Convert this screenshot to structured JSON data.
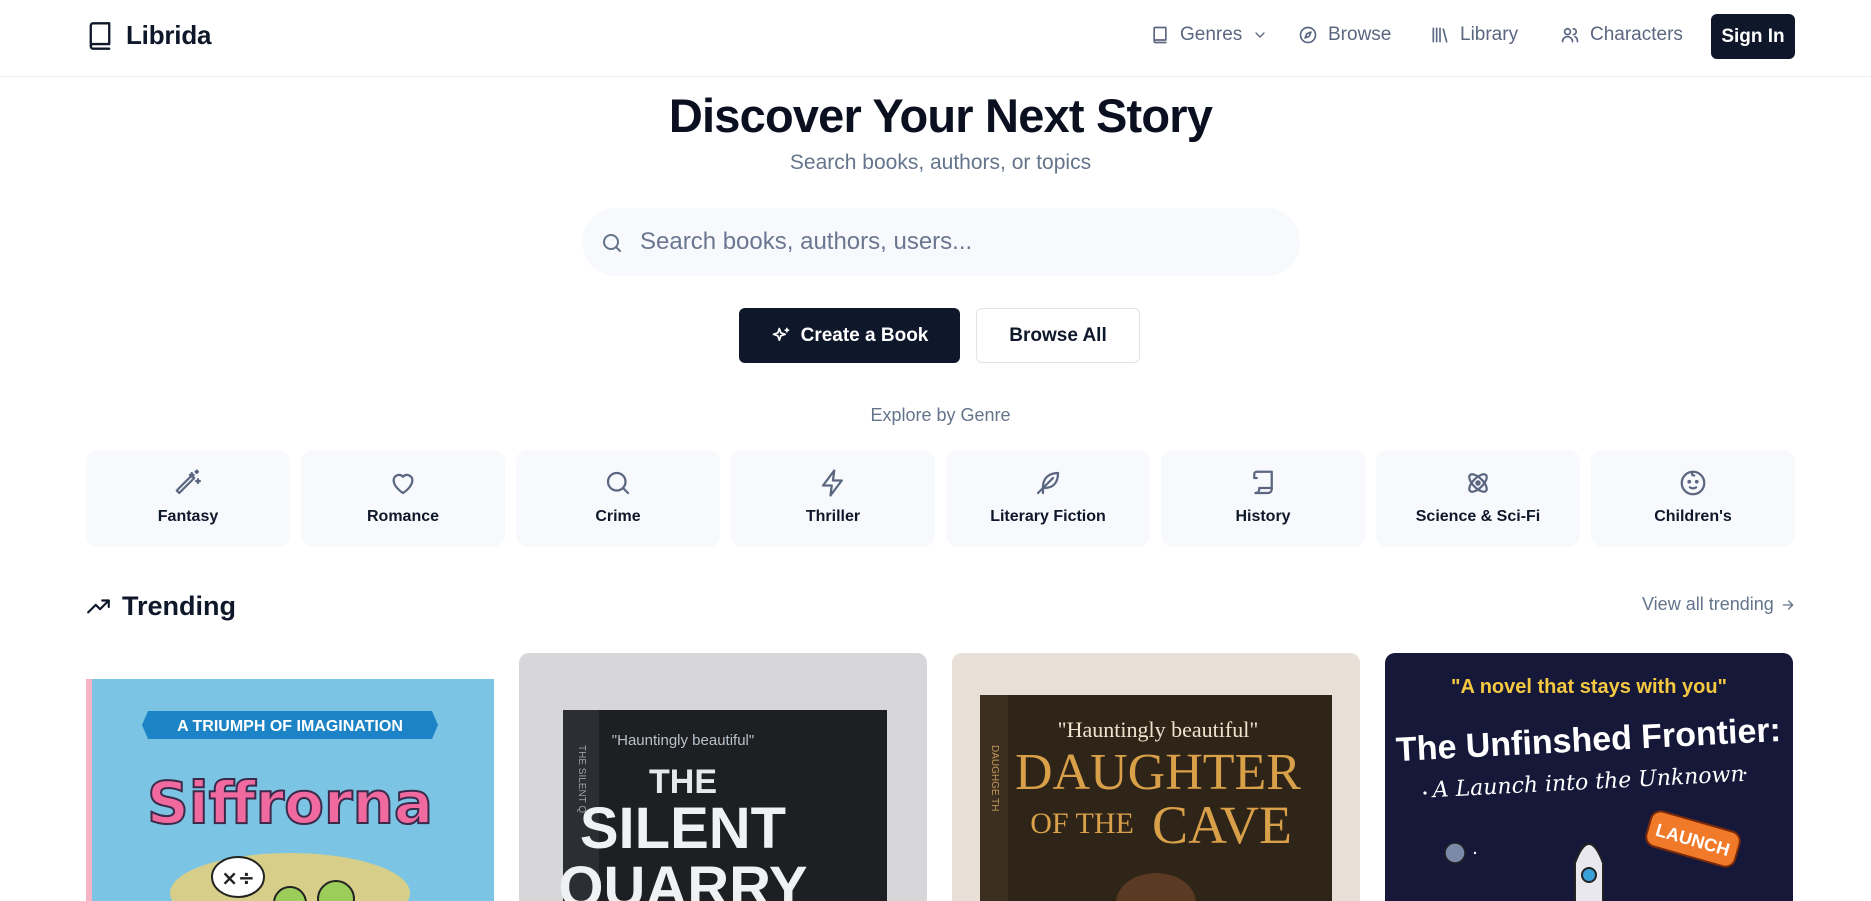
{
  "header": {
    "brand": "Librida",
    "nav": [
      {
        "label": "Genres",
        "icon": "book-icon"
      },
      {
        "label": "Browse",
        "icon": "compass-icon"
      },
      {
        "label": "Library",
        "icon": "library-icon"
      },
      {
        "label": "Characters",
        "icon": "users-icon"
      }
    ],
    "signin": "Sign In"
  },
  "hero": {
    "title": "Discover Your Next Story",
    "subtitle": "Search books, authors, or topics",
    "search_placeholder": "Search books, authors, users...",
    "create_button": "Create a Book",
    "browse_button": "Browse All"
  },
  "explore_label": "Explore by Genre",
  "genres": [
    {
      "label": "Fantasy",
      "icon": "magic-wand-icon"
    },
    {
      "label": "Romance",
      "icon": "heart-icon"
    },
    {
      "label": "Crime",
      "icon": "search-icon"
    },
    {
      "label": "Thriller",
      "icon": "lightning-icon"
    },
    {
      "label": "Literary Fiction",
      "icon": "feather-icon"
    },
    {
      "label": "History",
      "icon": "scroll-icon"
    },
    {
      "label": "Science & Sci-Fi",
      "icon": "atom-icon"
    },
    {
      "label": "Children's",
      "icon": "baby-icon"
    }
  ],
  "trending": {
    "title": "Trending",
    "view_all": "View all trending",
    "books": [
      {
        "banner": "A TRIUMPH OF IMAGINATION",
        "title": "Siffrorna",
        "colors": [
          "#79c2e2",
          "#f5d36b"
        ]
      },
      {
        "quote": "\"Hauntingly beautiful\"",
        "title_line1": "THE",
        "title_line2": "SILENT",
        "title_line3": "QUARRY",
        "spine": "THE SILENT Q"
      },
      {
        "quote": "\"Hauntingly beautiful\"",
        "title_line1": "DAUGHTER",
        "title_line2": "OF THE",
        "title_line3": "CAVE",
        "spine": "DAUGHGE TH"
      },
      {
        "quote": "\"A novel that stays with you\"",
        "title_line1": "The Unfinshed Frontier:",
        "title_line2": "A Launch into the Unknown",
        "badge": "LAUNCH"
      }
    ]
  }
}
